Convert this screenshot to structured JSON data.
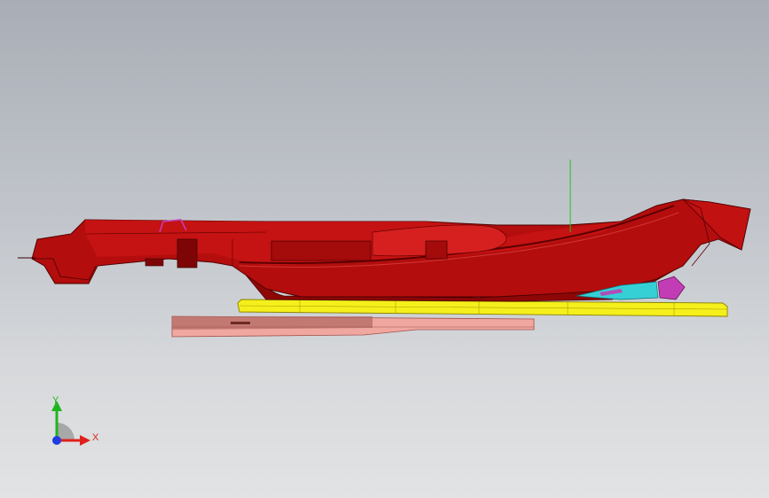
{
  "viewport": {
    "background_top": "#a9adb5",
    "background_bottom": "#e2e3e4"
  },
  "model": {
    "body_color": "#b30d0d",
    "body_dark": "#7e0505",
    "plate_color": "#f5ef1c",
    "base_color": "#f0a7a0",
    "accent_cyan": "#35d0d6",
    "accent_magenta": "#c23db5",
    "guide_line_color": "#22c41a"
  },
  "triad": {
    "x_label": "X",
    "y_label": "Y",
    "x_color": "#e0201a",
    "y_color": "#1fb51f",
    "z_color": "#1f3ce0"
  }
}
